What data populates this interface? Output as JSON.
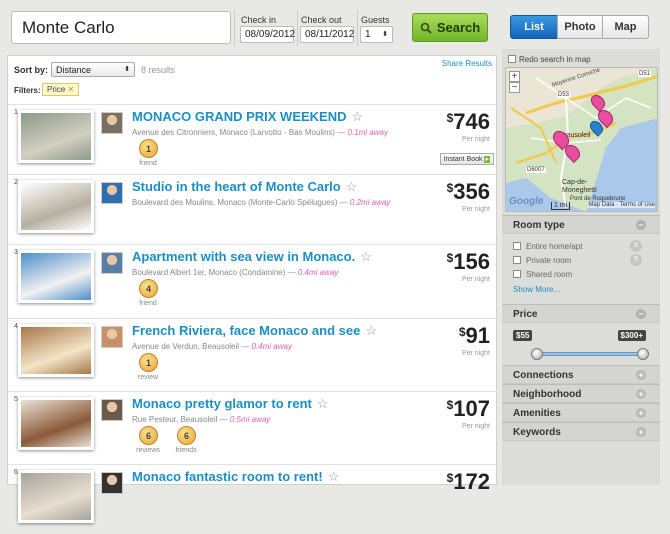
{
  "search": {
    "location": "Monte Carlo",
    "checkin_label": "Check in",
    "checkin": "08/09/2012",
    "checkout_label": "Check out",
    "checkout": "08/11/2012",
    "guests_label": "Guests",
    "guests": "1",
    "button": "Search"
  },
  "views": {
    "list": "List",
    "photo": "Photo",
    "map": "Map",
    "active": "List"
  },
  "sort": {
    "label": "Sort by:",
    "value": "Distance",
    "count": "8 results",
    "share": "Share Results"
  },
  "filters": {
    "label": "Filters:",
    "chip": "Price"
  },
  "listings": [
    {
      "n": "1",
      "title": "MONACO GRAND PRIX WEEKEND",
      "address": "Avenue des Citronniers, Monaco (Larvotto - Bas Moulins)",
      "away": "0.1mi away",
      "price": "746",
      "per": "Per night",
      "badges": [
        {
          "v": "1",
          "l": "friend"
        }
      ],
      "instant": "Instant Book"
    },
    {
      "n": "2",
      "title": "Studio in the heart of Monte Carlo",
      "address": "Boulevard des Moulins, Monaco (Monte-Carlo Spélugues)",
      "away": "0.2mi away",
      "price": "356",
      "per": "Per night",
      "badges": []
    },
    {
      "n": "3",
      "title": "Apartment with sea view in Monaco.",
      "address": "Boulevard Albert 1er, Monaco (Condamine)",
      "away": "0.4mi away",
      "price": "156",
      "per": "Per night",
      "badges": [
        {
          "v": "4",
          "l": "friend"
        }
      ]
    },
    {
      "n": "4",
      "title": "French Riviera, face Monaco and see",
      "address": "Avenue de Verdun, Beausoleil",
      "away": "0.4mi away",
      "price": "91",
      "per": "Per night",
      "badges": [
        {
          "v": "1",
          "l": "review"
        }
      ]
    },
    {
      "n": "5",
      "title": "Monaco pretty glamor to rent",
      "address": "Rue Pesteur, Beausoleil",
      "away": "0.5mi away",
      "price": "107",
      "per": "Per night",
      "badges": [
        {
          "v": "6",
          "l": "reviews"
        },
        {
          "v": "6",
          "l": "friends"
        }
      ]
    },
    {
      "n": "6",
      "title": "Monaco fantastic room to rent!",
      "address": "",
      "away": "",
      "price": "172",
      "per": "",
      "badges": []
    }
  ],
  "map": {
    "redo": "Redo search in map",
    "zoom_in": "+",
    "zoom_out": "−",
    "places": [
      "Beausoleil",
      "Cap-de-Moneghetti",
      "Pont de Roquebrune",
      "Moyenne Corniche",
      "D53",
      "D6007",
      "D51"
    ],
    "scale": "1 mi",
    "credits": "Map Data · Terms of Use",
    "brand": "Google"
  },
  "room_type": {
    "title": "Room type",
    "options": [
      {
        "label": "Entire home/apt",
        "count": "3"
      },
      {
        "label": "Private room",
        "count": "5"
      },
      {
        "label": "Shared room",
        "count": ""
      }
    ],
    "more": "Show More..."
  },
  "price": {
    "title": "Price",
    "min": "$55",
    "max": "$300+",
    "min_level": 0,
    "max_level": 1
  },
  "sections": [
    "Connections",
    "Neighborhood",
    "Amenities",
    "Keywords"
  ],
  "colors": {
    "accent": "#1b8fc5",
    "search_green": "#7bbd30",
    "active_tab": "#1473c6"
  }
}
